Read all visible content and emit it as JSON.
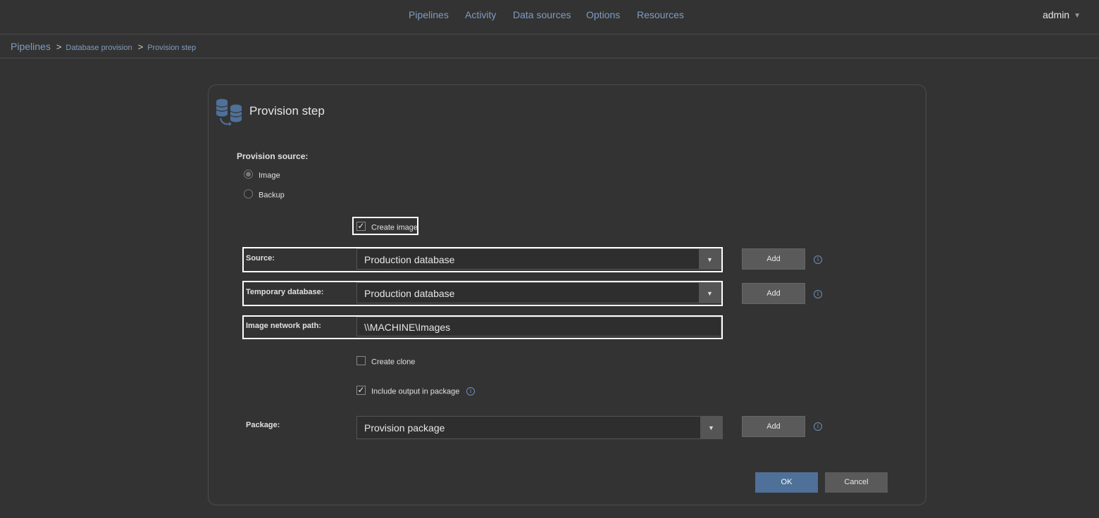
{
  "nav": {
    "items": [
      "Pipelines",
      "Activity",
      "Data sources",
      "Options",
      "Resources"
    ],
    "user": "admin"
  },
  "breadcrumb": {
    "root": "Pipelines",
    "level1": "Database provision",
    "level2": "Provision step"
  },
  "panel": {
    "title": "Provision step",
    "icon": "database-provision-icon",
    "provision_source_label": "Provision source:",
    "radio_image": "Image",
    "radio_backup": "Backup",
    "selected_source": "Image",
    "create_image_label": "Create image",
    "create_image_checked": true,
    "source_label": "Source:",
    "source_value": "Production database",
    "temp_db_label": "Temporary database:",
    "temp_db_value": "Production database",
    "image_path_label": "Image network path:",
    "image_path_value": "\\\\MACHINE\\Images",
    "create_clone_label": "Create clone",
    "create_clone_checked": false,
    "include_output_label": "Include output in package",
    "include_output_checked": true,
    "package_label": "Package:",
    "package_value": "Provision package",
    "add_label": "Add",
    "ok_label": "OK",
    "cancel_label": "Cancel"
  },
  "colors": {
    "background": "#333333",
    "link": "#7f9cc0",
    "primary_button": "#4f7099",
    "secondary_button": "#5a5a5a"
  }
}
